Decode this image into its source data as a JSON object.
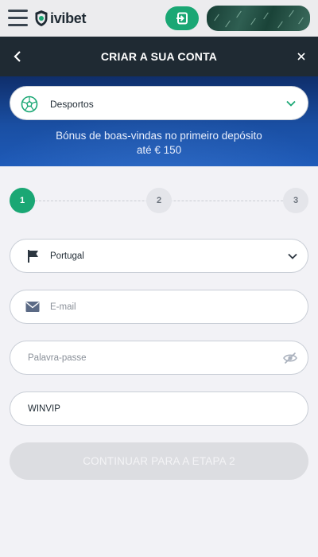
{
  "header": {
    "menu_icon": "hamburger-menu-icon",
    "logo_text": "ivibet",
    "login_icon": "login-icon",
    "colors": {
      "brand_green": "#1aa774",
      "dark": "#1f2a33"
    }
  },
  "titlebar": {
    "title": "CRIAR A SUA CONTA",
    "back_icon": "chevron-left-icon",
    "close_icon": "close-icon"
  },
  "bonus": {
    "sport_select_value": "Desportos",
    "sport_icon": "soccer-ball-icon",
    "line1": "Bónus de boas-vindas no primeiro depósito",
    "line2": "até € 150"
  },
  "stepper": {
    "steps": [
      "1",
      "2",
      "3"
    ],
    "current": 1
  },
  "form": {
    "country_value": "Portugal",
    "country_icon": "flag-icon",
    "email_placeholder": "E-mail",
    "email_icon": "envelope-icon",
    "password_placeholder": "Palavra-passe",
    "password_toggle_icon": "eye-hidden-icon",
    "promo_code_value": "WINVIP"
  },
  "continue_button": {
    "label": "CONTINUAR PARA A ETAPA 2",
    "enabled": false
  }
}
